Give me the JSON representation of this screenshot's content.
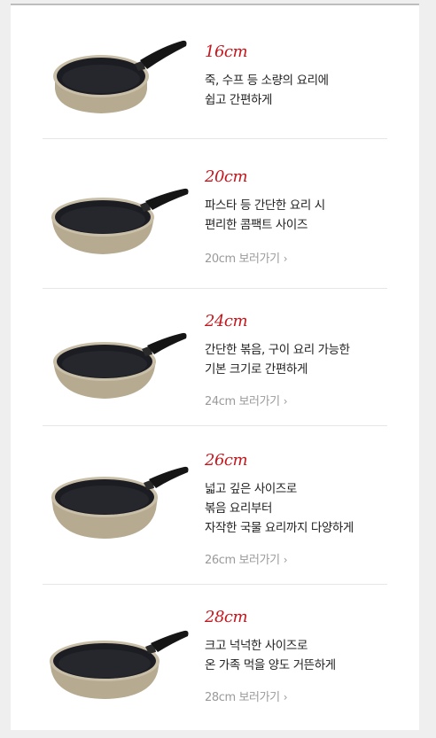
{
  "products": [
    {
      "size": "16cm",
      "desc_lines": [
        "죽, 수프 등 소량의 요리에",
        "쉽고 간편하게"
      ],
      "link": ""
    },
    {
      "size": "20cm",
      "desc_lines": [
        "파스타 등 간단한 요리 시",
        "편리한 콤팩트 사이즈"
      ],
      "link": "20cm 보러가기"
    },
    {
      "size": "24cm",
      "desc_lines": [
        "간단한 볶음, 구이 요리 가능한",
        "기본 크기로 간편하게"
      ],
      "link": "24cm 보러가기"
    },
    {
      "size": "26cm",
      "desc_lines": [
        "넓고 깊은 사이즈로",
        "볶음 요리부터",
        "자작한 국물 요리까지 다양하게"
      ],
      "link": "26cm 보러가기"
    },
    {
      "size": "28cm",
      "desc_lines": [
        "크고 넉넉한 사이즈로",
        "온 가족 먹을 양도 거뜬하게"
      ],
      "link": "28cm 보러가기"
    }
  ],
  "link_chevron": "›",
  "colors": {
    "accent": "#c4161c",
    "text": "#222222",
    "muted": "#9a9a9a",
    "pan_body": "#b8ad95",
    "pan_inner": "#1c1d22",
    "handle": "#151515"
  },
  "icons": {
    "chevron": "chevron-right-icon",
    "pan": "frying-pan-image"
  }
}
